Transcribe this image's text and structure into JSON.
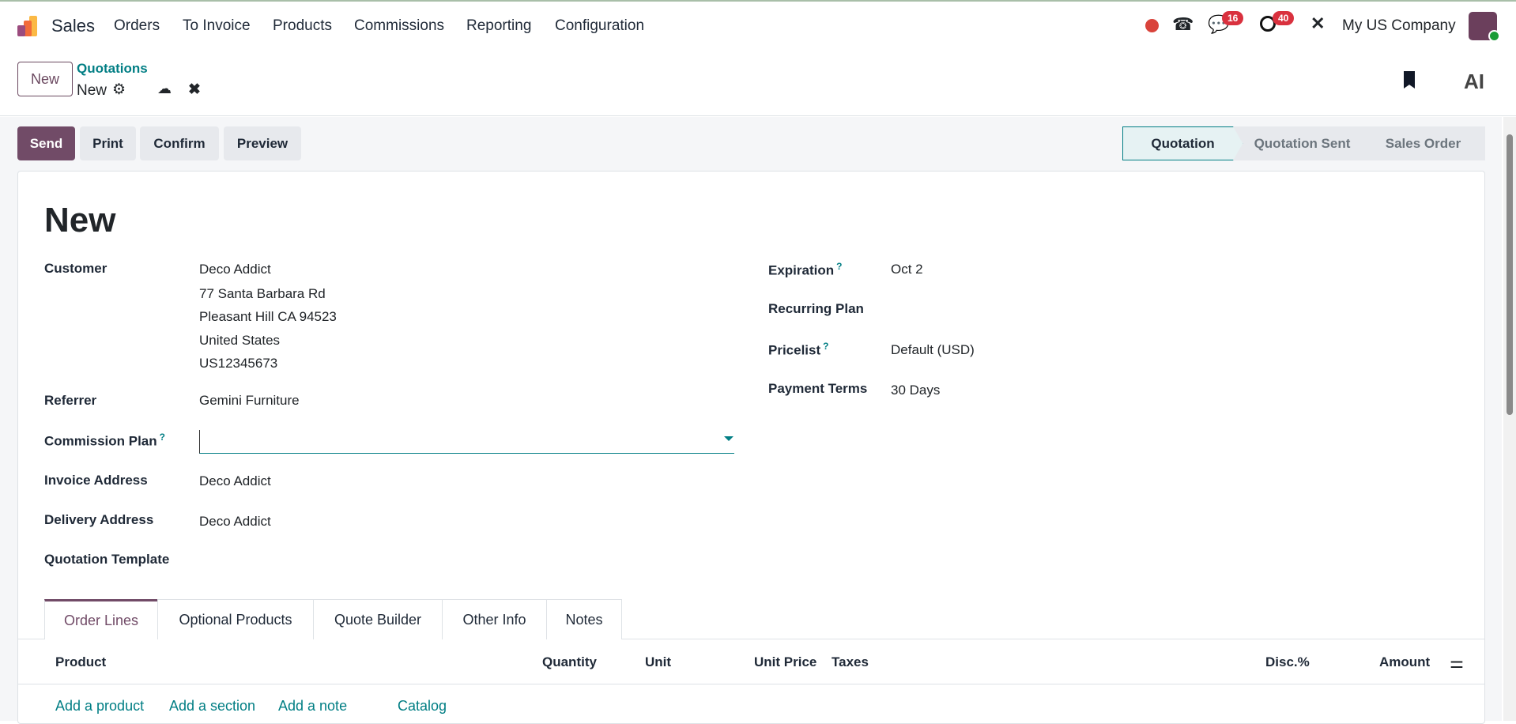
{
  "app": {
    "name": "Sales",
    "menu": [
      "Orders",
      "To Invoice",
      "Products",
      "Commissions",
      "Reporting",
      "Configuration"
    ],
    "messages_badge": "16",
    "activities_badge": "40",
    "company": "My US Company"
  },
  "control": {
    "new_label": "New",
    "breadcrumb_parent": "Quotations",
    "breadcrumb_current": "New"
  },
  "actions": {
    "send": "Send",
    "print": "Print",
    "confirm": "Confirm",
    "preview": "Preview"
  },
  "status": {
    "steps": [
      "Quotation",
      "Quotation Sent",
      "Sales Order"
    ],
    "active": "Quotation"
  },
  "form": {
    "title": "New",
    "customer_label": "Customer",
    "customer_lines": [
      "Deco Addict",
      "77 Santa Barbara Rd",
      "Pleasant Hill CA 94523",
      "United States",
      "US12345673"
    ],
    "referrer_label": "Referrer",
    "referrer": "Gemini Furniture",
    "commission_label": "Commission Plan",
    "commission_value": "",
    "invoice_label": "Invoice Address",
    "invoice": "Deco Addict",
    "delivery_label": "Delivery Address",
    "delivery": "Deco Addict",
    "template_label": "Quotation Template",
    "expiration_label": "Expiration",
    "expiration": "Oct 2",
    "recurring_label": "Recurring Plan",
    "pricelist_label": "Pricelist",
    "pricelist": "Default (USD)",
    "terms_label": "Payment Terms",
    "terms": "30 Days",
    "help": "?"
  },
  "tabs": [
    "Order Lines",
    "Optional Products",
    "Quote Builder",
    "Other Info",
    "Notes"
  ],
  "table": {
    "headers": {
      "product": "Product",
      "quantity": "Quantity",
      "unit": "Unit",
      "unit_price": "Unit Price",
      "taxes": "Taxes",
      "disc": "Disc.%",
      "amount": "Amount"
    },
    "links": [
      "Add a product",
      "Add a section",
      "Add a note",
      "Catalog"
    ]
  }
}
